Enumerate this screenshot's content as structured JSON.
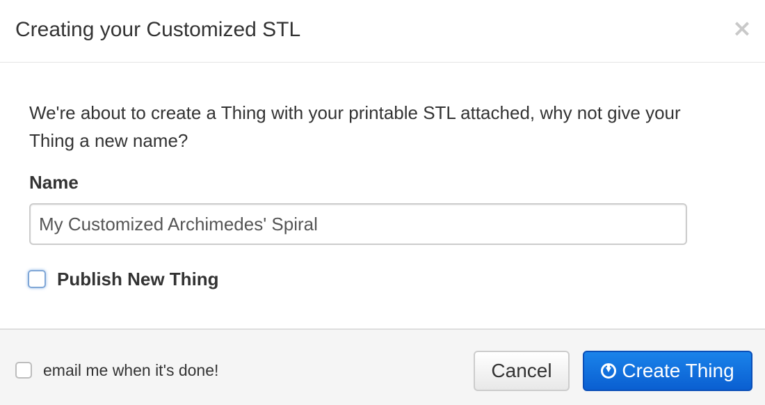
{
  "dialog": {
    "title": "Creating your Customized STL",
    "close_label": "×"
  },
  "body": {
    "intro": "We're about to create a Thing with your printable STL attached, why not give your Thing a new name?",
    "name_label": "Name",
    "name_value": "My Customized Archimedes' Spiral",
    "publish_label": "Publish New Thing",
    "publish_checked": false
  },
  "footer": {
    "email_label": "email me when it's done!",
    "email_checked": false,
    "cancel_label": "Cancel",
    "create_label": "Create Thing",
    "create_icon": "download-circle-icon"
  },
  "colors": {
    "primary": "#0a6ad8",
    "footer_bg": "#f5f5f5",
    "focus_ring": "#7fa6d6"
  }
}
